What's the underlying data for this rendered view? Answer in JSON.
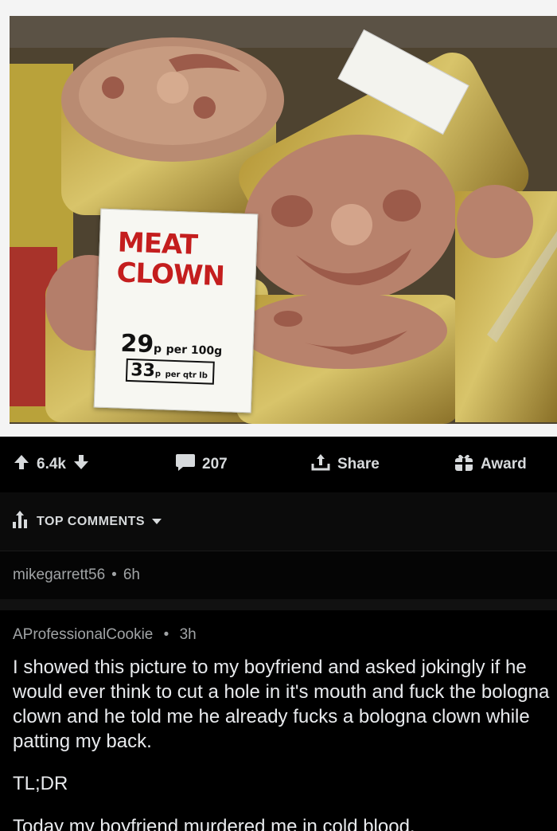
{
  "image": {
    "sign": {
      "title": "MEAT CLOWN",
      "price1_amount": "29",
      "price1_unit": "p",
      "price1_rest": "per 100g",
      "price2_amount": "33",
      "price2_unit": "p",
      "price2_rest": "per qtr lb"
    }
  },
  "actions": {
    "upvote_count": "6.4k",
    "comment_count": "207",
    "share_label": "Share",
    "award_label": "Award"
  },
  "sort": {
    "label": "TOP COMMENTS"
  },
  "comments": [
    {
      "author": "mikegarrett56",
      "age": "6h"
    },
    {
      "author": "AProfessionalCookie",
      "age": "3h",
      "body_1": "I showed this picture to my boyfriend and asked jokingly if he would ever think to cut a hole in it's mouth and fuck the bologna clown and he told me he already fucks a bologna clown while patting my back.",
      "body_2": "TL;DR",
      "body_3": "Today my boyfriend murdered me in cold blood."
    }
  ],
  "colors": {
    "background": "#000000",
    "text": "#d7dadc",
    "meta": "#a0a3a5",
    "sign_red": "#c41e1e"
  }
}
